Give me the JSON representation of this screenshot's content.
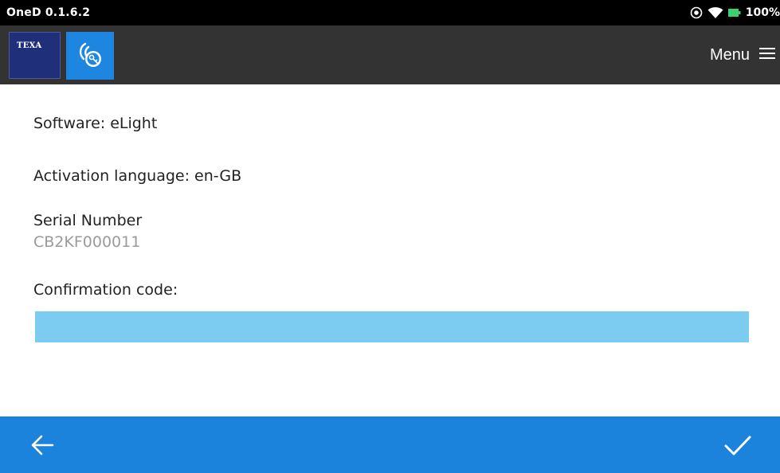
{
  "status_bar": {
    "title": "OneD 0.1.6.2",
    "battery_label": "100%",
    "icons": [
      "record-icon",
      "wifi-icon",
      "battery-icon"
    ]
  },
  "app_bar": {
    "logo_text": "TEXA",
    "app_icon": "activation-key-icon",
    "menu_label": "Menu",
    "menu_icon": "hamburger-icon"
  },
  "content": {
    "software_line": "Software: eLight",
    "language_line": "Activation language: en-GB",
    "serial_label": "Serial Number",
    "serial_value": "CB2KF000011",
    "confirmation_label": "Confirmation code:",
    "confirmation_value": ""
  },
  "bottom_bar": {
    "back_icon": "arrow-left-icon",
    "confirm_icon": "checkmark-icon"
  },
  "colors": {
    "status_bar_bg": "#000000",
    "app_bar_bg": "#333333",
    "texa_blue": "#1f2f7a",
    "accent_blue": "#1c83dc",
    "input_bg": "#7ccbf0",
    "serial_gray": "#9a9a9a"
  }
}
